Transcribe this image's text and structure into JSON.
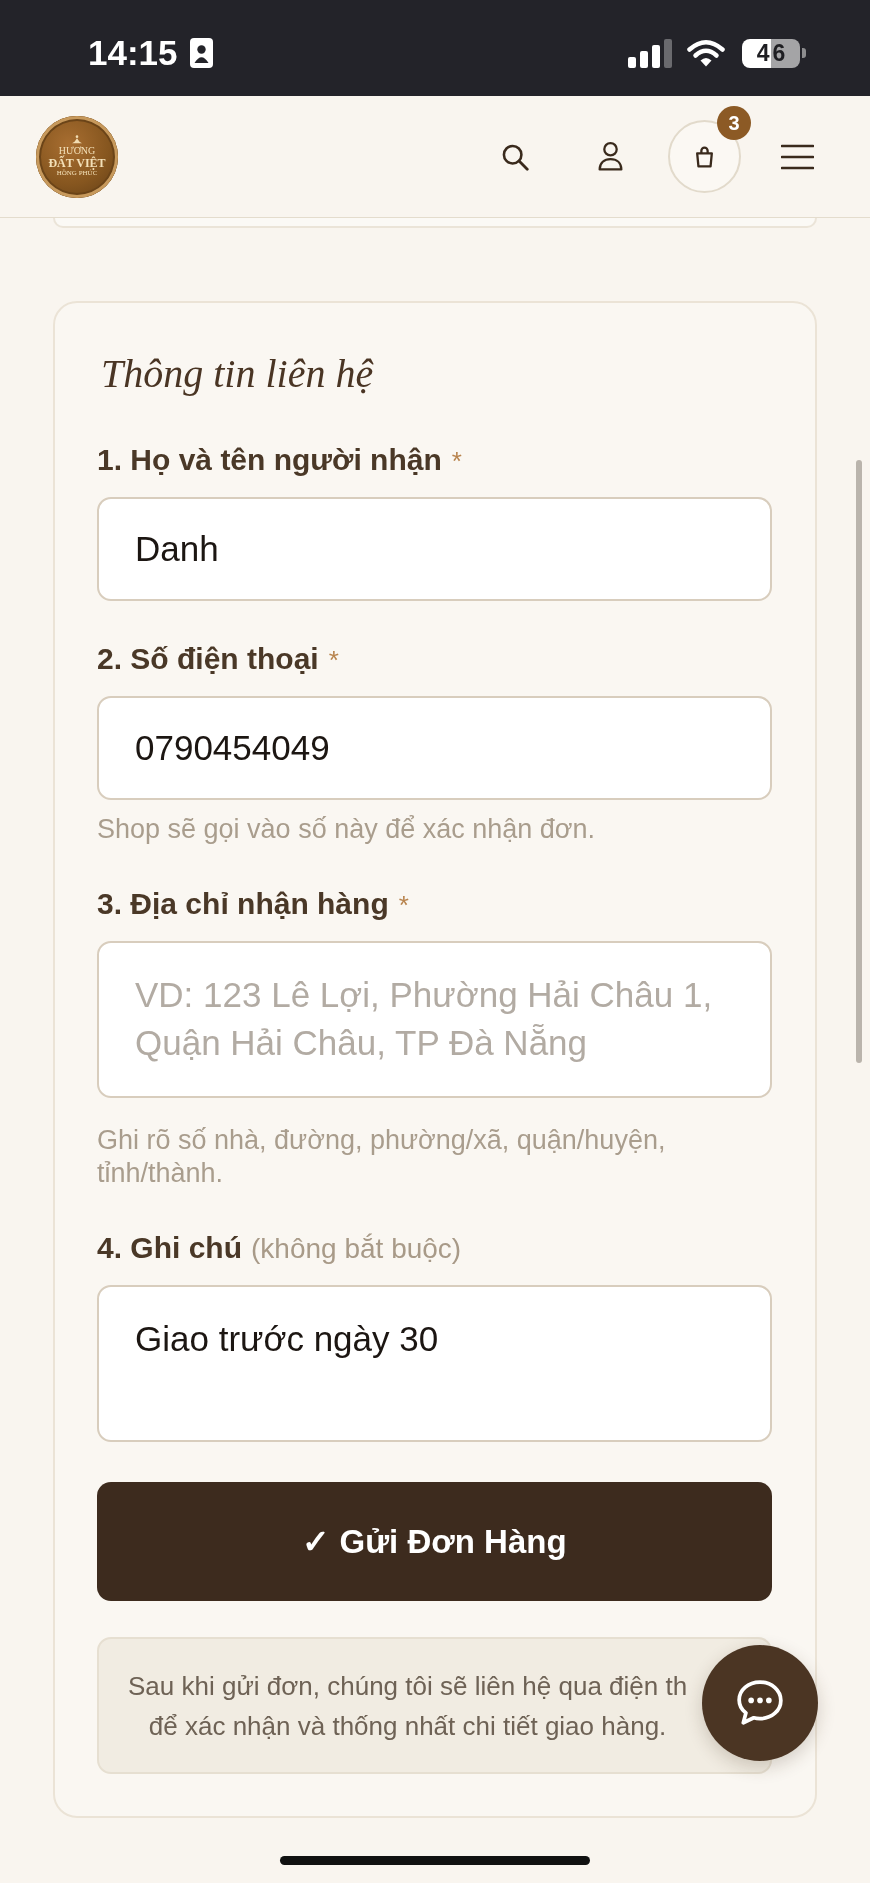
{
  "status_bar": {
    "time": "14:15",
    "battery": "46"
  },
  "header": {
    "logo": {
      "lines": [
        "HƯƠNG",
        "ĐẤT VIỆT",
        "HỒNG PHÚC"
      ]
    },
    "cart_count": "3"
  },
  "form": {
    "title": "Thông tin liên hệ",
    "fields": [
      {
        "kind": "input",
        "label": "1. Họ và tên người nhận",
        "required_mark": "*",
        "value": "Danh"
      },
      {
        "kind": "input",
        "label": "2. Số điện thoại",
        "required_mark": "*",
        "value": "0790454049",
        "hint": "Shop sẽ gọi vào số này để xác nhận đơn."
      },
      {
        "kind": "textarea",
        "label": "3. Địa chỉ nhận hàng",
        "required_mark": "*",
        "placeholder": "VD: 123 Lê Lợi, Phường Hải Châu 1, Quận Hải Châu, TP Đà Nẵng",
        "hint": "Ghi rõ số nhà, đường, phường/xã, quận/huyện, tỉnh/thành."
      },
      {
        "kind": "textarea",
        "label": "4. Ghi chú",
        "optional_note": "(không bắt buộc)",
        "value": "Giao trước ngày 30"
      }
    ],
    "submit_button": "✓ Gửi Đơn Hàng",
    "info_lines": [
      "Sau khi gửi đơn, chúng tôi sẽ liên hệ qua điện th",
      "để xác nhận và thống nhất chi tiết giao hàng."
    ]
  }
}
